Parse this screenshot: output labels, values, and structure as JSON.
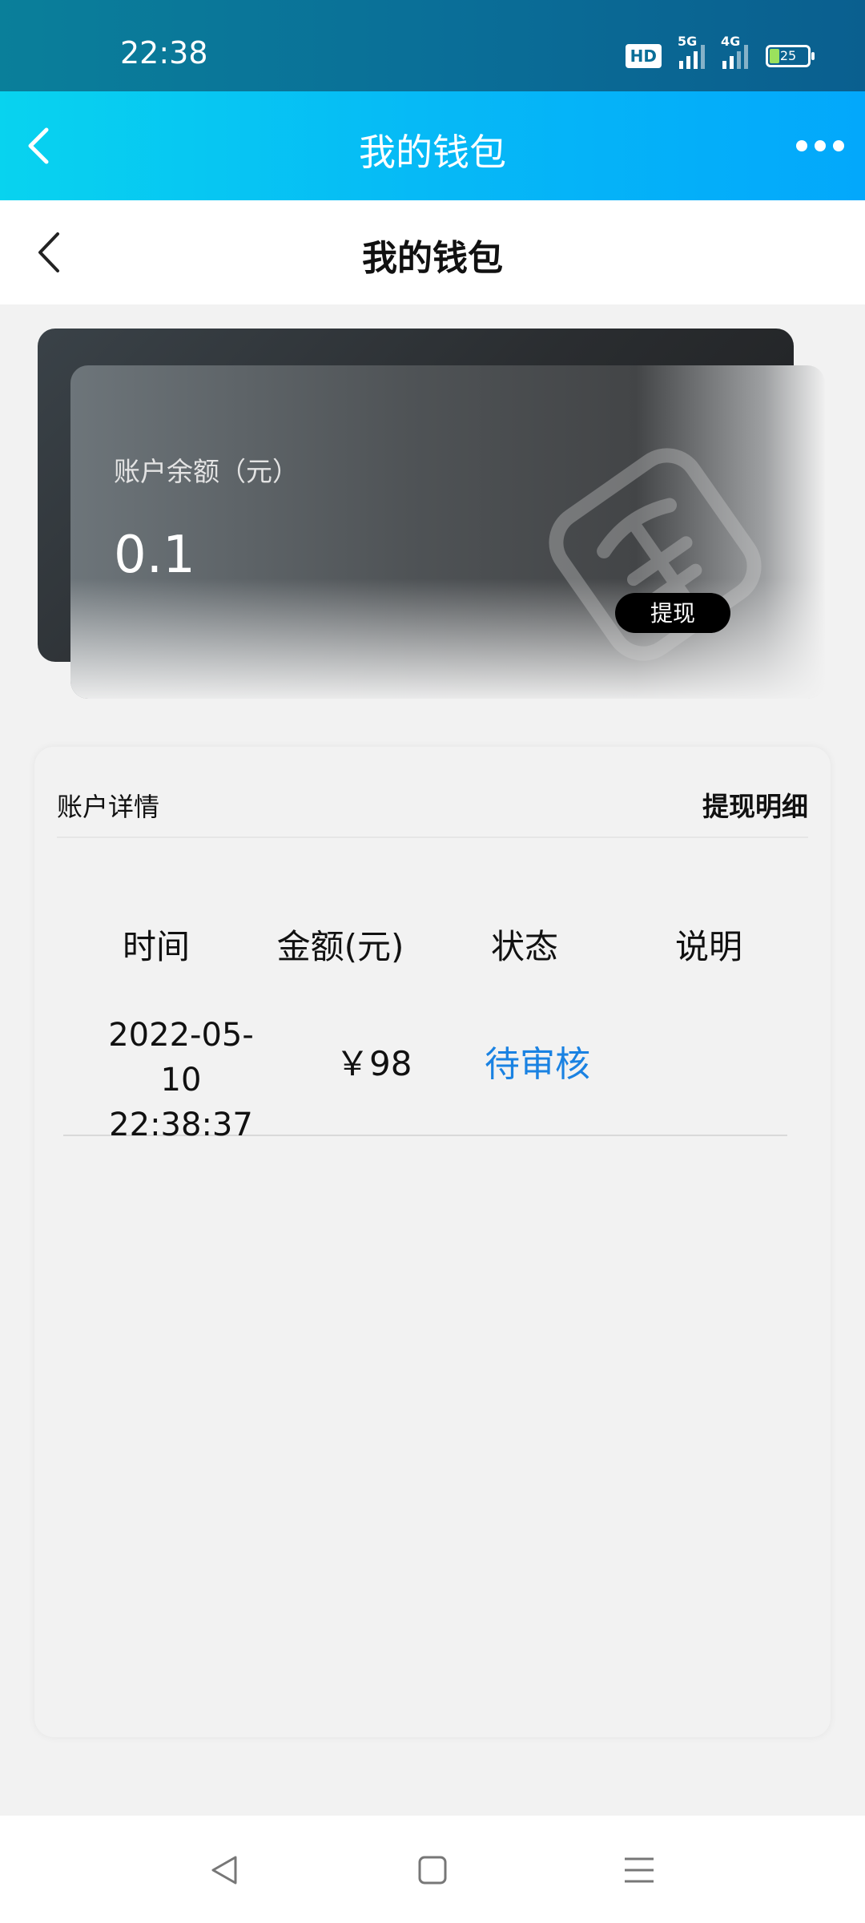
{
  "status_bar": {
    "time": "22:38",
    "hd_label": "HD",
    "network_5g": "5G",
    "network_4g": "4G",
    "battery": "25"
  },
  "app_header": {
    "title": "我的钱包"
  },
  "page_header": {
    "title": "我的钱包"
  },
  "card": {
    "balance_label": "账户余额（元）",
    "balance_value": "0.1",
    "withdraw_label": "提现",
    "logo_icon": "wallet-logo-icon"
  },
  "details": {
    "title": "账户详情",
    "link": "提现明细",
    "columns": [
      "时间",
      "金额(元)",
      "状态",
      "说明"
    ],
    "rows": [
      {
        "date": "2022-05-10",
        "time": "22:38:37",
        "amount": "￥98",
        "status": "待审核",
        "note": ""
      }
    ]
  },
  "colors": {
    "header_start": "#08d3ef",
    "header_end": "#03a8fb",
    "status_pending": "#1a82e2"
  }
}
